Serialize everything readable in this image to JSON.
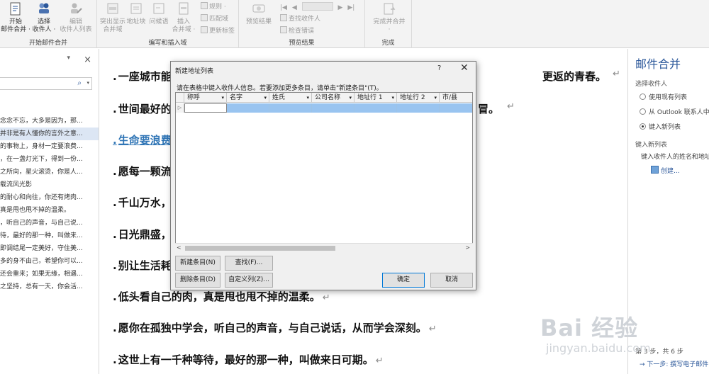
{
  "ribbon": {
    "group_start": {
      "label": "开始邮件合并",
      "start_label": "开始\n邮件合并 ·",
      "select_label": "选择\n收件人 ·",
      "edit_label": "编辑\n收件人列表"
    },
    "group_write": {
      "label": "编写和插入域",
      "highlight_label": "突出显示\n合并域",
      "address_label": "地址块",
      "greeting_label": "问候语",
      "insert_label": "插入\n合并域 ·",
      "rules_label": "规则 ·",
      "match_label": "匹配域",
      "update_label": "更新标签"
    },
    "group_preview": {
      "label": "预览结果",
      "preview_label": "预览结果",
      "find_label": "查找收件人",
      "check_label": "检查错误"
    },
    "group_finish": {
      "label": "完成",
      "finish_label": "完成并合并\n·"
    }
  },
  "navpane": {
    "close": "×",
    "pin": "▾",
    "search_icon": "⌕",
    "items": [
      "念念不忘，大多是因为，那...",
      "并非是有人懂你的言外之意...",
      "的事物上，身材一定要浪费...",
      "，在一盏灯光下，得到一份...",
      "之所向，星火滚烫，你是人...",
      "载流风光影",
      "的耐心和向往，你还有烤肉...",
      "真是甩也甩不掉的温柔。",
      "，听自己的声音，与自己说...",
      "待，最好的那一种，叫做来...",
      "即调结尾一定美好，守住美...",
      "多的身不由己，希望你可以...",
      "还会重来；如果无缘，相遇...",
      "之坚持，总有一天，你会活..."
    ],
    "selected_index": 1
  },
  "doc": {
    "paragraphs": [
      {
        "text": "一座城市能",
        "tail": "更返的青春。",
        "mark": "↵",
        "link": false
      },
      {
        "text": "世间最好的",
        "tail": "冒。",
        "mark": "↵",
        "link": false
      },
      {
        "text": "生命要浪费",
        "tail": "",
        "mark": "",
        "link": true
      },
      {
        "text": "愿每一颗流",
        "tail": "",
        "mark": "",
        "link": false
      },
      {
        "text": "千山万水，",
        "tail": "",
        "mark": "",
        "link": false
      },
      {
        "text": "日光鼎盛，",
        "tail": "",
        "mark": "",
        "link": false
      },
      {
        "text": "别让生活耗",
        "tail": "",
        "mark": "",
        "link": false
      },
      {
        "text": "低头看自己的肉，真是甩也甩不掉的温柔。",
        "tail": "",
        "mark": "↵",
        "link": false
      },
      {
        "text": "愿你在孤独中学会，听自己的声音，与自己说话，从而学会深刻。",
        "tail": "",
        "mark": "↵",
        "link": false
      },
      {
        "text": "这世上有一千种等待，最好的那一种，叫做来日可期。",
        "tail": "",
        "mark": "↵",
        "link": false
      }
    ]
  },
  "rightpane": {
    "title": "邮件合并",
    "select_recipients": "选择收件人",
    "radio_existing": "使用现有列表",
    "radio_outlook": "从 Outlook 联系人中",
    "radio_new": "键入新列表",
    "new_list_heading": "键入新列表",
    "new_list_desc": "键入收件人的姓名和地址",
    "create_link": "创建...",
    "step": "第 3 步，共 6 步",
    "next": "→ 下一步: 撰写电子邮件"
  },
  "watermark": {
    "main": "Bai 经验",
    "sub": "jingyan.baidu.com"
  },
  "dialog": {
    "title": "新建地址列表",
    "help": "?",
    "close": "✕",
    "instruction": "请在表格中键入收件人信息。若要添加更多条目，请单击\"新建条目\"(T)。",
    "columns": [
      "称呼",
      "名字",
      "姓氏",
      "公司名称",
      "地址行 1",
      "地址行 2",
      "市/县"
    ],
    "row_indicator": "▷",
    "buttons": {
      "new_entry": "新建条目(N)",
      "find": "查找(F)...",
      "delete_entry": "删除条目(D)",
      "customize": "自定义列(Z)...",
      "ok": "确定",
      "cancel": "取消"
    }
  }
}
